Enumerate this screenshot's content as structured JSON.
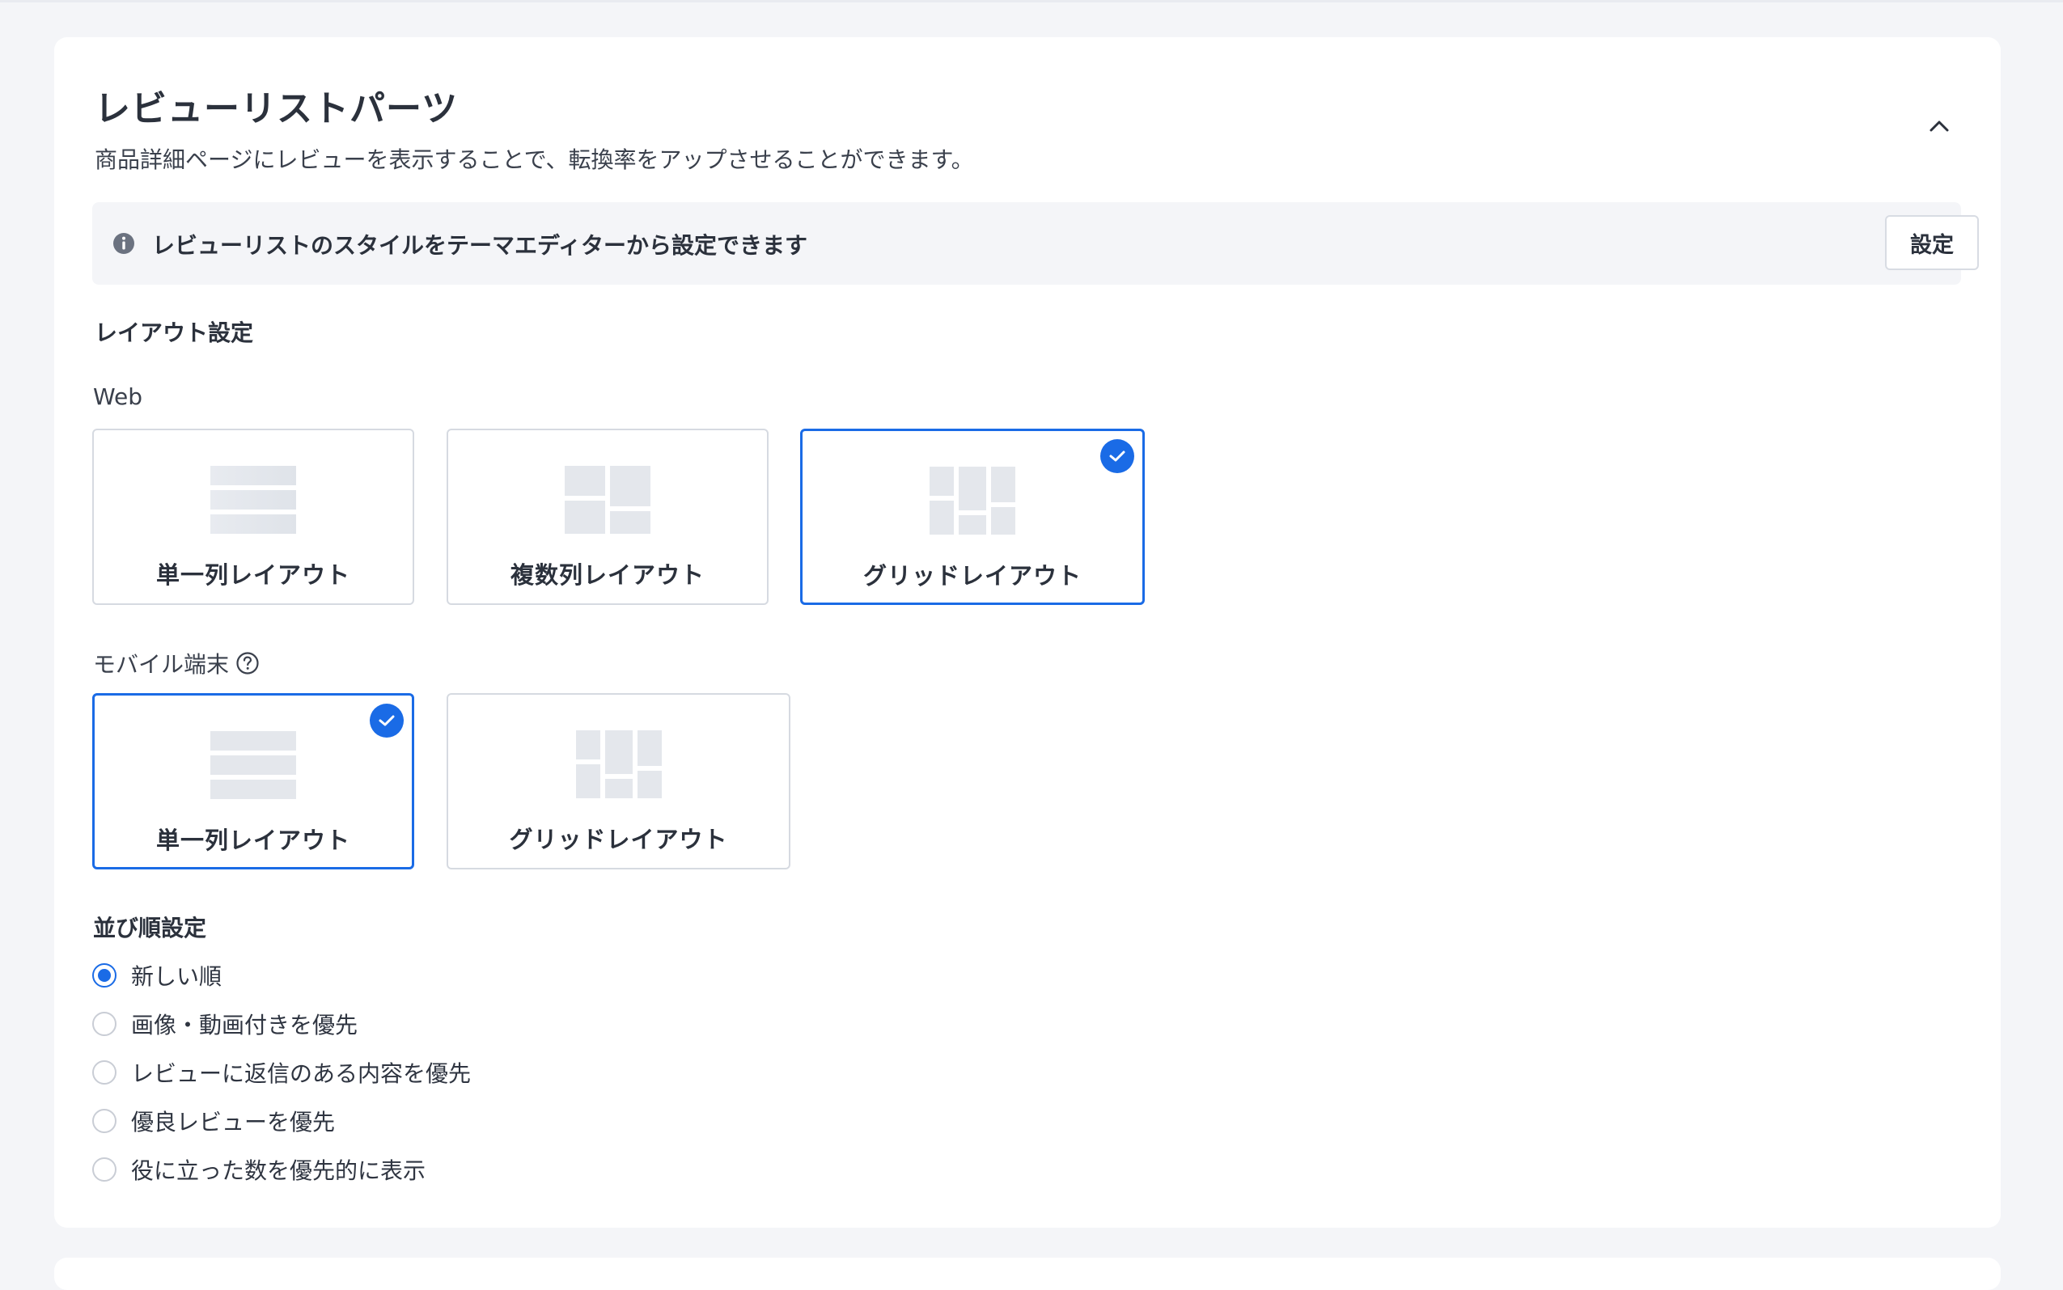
{
  "panel": {
    "title": "レビューリストパーツ",
    "description": "商品詳細ページにレビューを表示することで、転換率をアップさせることができます。",
    "collapse_icon": "chevron-up-icon"
  },
  "info_banner": {
    "icon": "info-icon",
    "text": "レビューリストのスタイルをテーマエディターから設定できます",
    "button_label": "設定"
  },
  "layout_settings": {
    "heading": "レイアウト設定",
    "web": {
      "label": "Web",
      "options": [
        {
          "label": "単一列レイアウト",
          "icon": "single-column-layout-icon",
          "selected": false
        },
        {
          "label": "複数列レイアウト",
          "icon": "multi-column-layout-icon",
          "selected": false
        },
        {
          "label": "グリッドレイアウト",
          "icon": "grid-layout-icon",
          "selected": true
        }
      ]
    },
    "mobile": {
      "label": "モバイル端末",
      "help_icon": "question-circle-icon",
      "options": [
        {
          "label": "単一列レイアウト",
          "icon": "single-column-layout-icon",
          "selected": true
        },
        {
          "label": "グリッドレイアウト",
          "icon": "grid-layout-icon",
          "selected": false
        }
      ]
    }
  },
  "sort_settings": {
    "heading": "並び順設定",
    "options": [
      {
        "label": "新しい順",
        "checked": true
      },
      {
        "label": "画像・動画付きを優先",
        "checked": false
      },
      {
        "label": "レビューに返信のある内容を優先",
        "checked": false
      },
      {
        "label": "優良レビューを優先",
        "checked": false
      },
      {
        "label": "役に立った数を優先的に表示",
        "checked": false
      }
    ]
  },
  "colors": {
    "accent": "#1a6be6",
    "background": "#f4f5f8",
    "card": "#ffffff",
    "thumb_fill": "#e4e7ec"
  }
}
